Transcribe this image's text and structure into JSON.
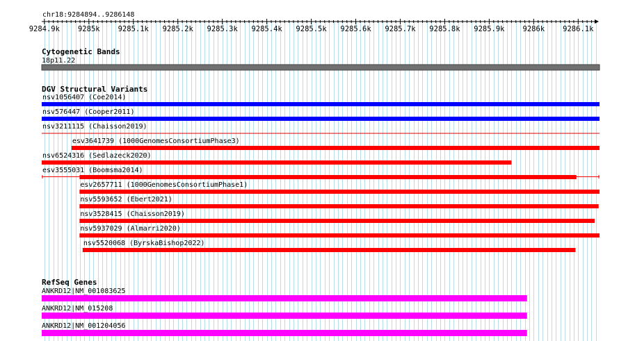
{
  "ruler": {
    "region_label": "chr18:9284894..9286148",
    "start": 9284894,
    "end": 9286148,
    "ticks": [
      "9284.9k",
      "9285k",
      "9285.1k",
      "9285.2k",
      "9285.3k",
      "9285.4k",
      "9285.5k",
      "9285.6k",
      "9285.7k",
      "9285.8k",
      "9285.9k",
      "9286k",
      "9286.1k"
    ]
  },
  "tracks": {
    "cyto": {
      "title": "Cytogenetic Bands",
      "band_label": "18p11.22",
      "color": "#707070"
    },
    "dgv": {
      "title": "DGV Structural Variants",
      "features": [
        {
          "id": "nsv1056407",
          "source": "Coe2014",
          "start": 9284894,
          "end": 9286148,
          "color": "#0000ff",
          "style": "bar"
        },
        {
          "id": "nsv576447",
          "source": "Cooper2011",
          "start": 9284894,
          "end": 9286148,
          "color": "#0000ff",
          "style": "bar"
        },
        {
          "id": "nsv3211115",
          "source": "Chaisson2019",
          "start": 9284894,
          "end": 9286148,
          "color": "#e00000",
          "style": "line"
        },
        {
          "id": "esv3641739",
          "source": "1000GenomesConsortiumPhase3",
          "start": 9284961,
          "end": 9286148,
          "color": "#ff0000",
          "style": "bar"
        },
        {
          "id": "nsv6524316",
          "source": "Sedlazeck2020",
          "start": 9284894,
          "end": 9285950,
          "color": "#ff0000",
          "style": "bar"
        },
        {
          "id": "esv3555031",
          "source": "Boomsma2014",
          "start": 9284894,
          "end": 9286148,
          "color": "#ff0000",
          "style": "split",
          "thick_start": 9284979,
          "thick_end": 9286096
        },
        {
          "id": "esv2657711",
          "source": "1000GenomesConsortiumPhase1",
          "start": 9284979,
          "end": 9286148,
          "color": "#ff0000",
          "style": "bar"
        },
        {
          "id": "nsv5593652",
          "source": "Ebert2021",
          "start": 9284979,
          "end": 9286146,
          "color": "#ff0000",
          "style": "bar"
        },
        {
          "id": "nsv3528415",
          "source": "Chaisson2019",
          "start": 9284979,
          "end": 9286137,
          "color": "#ff0000",
          "style": "bar"
        },
        {
          "id": "nsv5937029",
          "source": "Almarri2020",
          "start": 9284979,
          "end": 9286148,
          "color": "#ff0000",
          "style": "bar"
        },
        {
          "id": "nsv5520068",
          "source": "ByrskaBishop2022",
          "start": 9284986,
          "end": 9286094,
          "color": "#ff0000",
          "style": "bar"
        }
      ]
    },
    "refseq": {
      "title": "RefSeq Genes",
      "features": [
        {
          "label": "ANKRD12|NM_001083625",
          "start": 9284894,
          "end": 9285985,
          "color": "#ff00ff"
        },
        {
          "label": "ANKRD12|NM_015208",
          "start": 9284894,
          "end": 9285985,
          "color": "#ff00ff"
        },
        {
          "label": "ANKRD12|NM_001204056",
          "start": 9284894,
          "end": 9285985,
          "color": "#ff00ff"
        }
      ]
    }
  },
  "colors": {
    "grid": "#b8dde6",
    "background": "#ffffff"
  }
}
